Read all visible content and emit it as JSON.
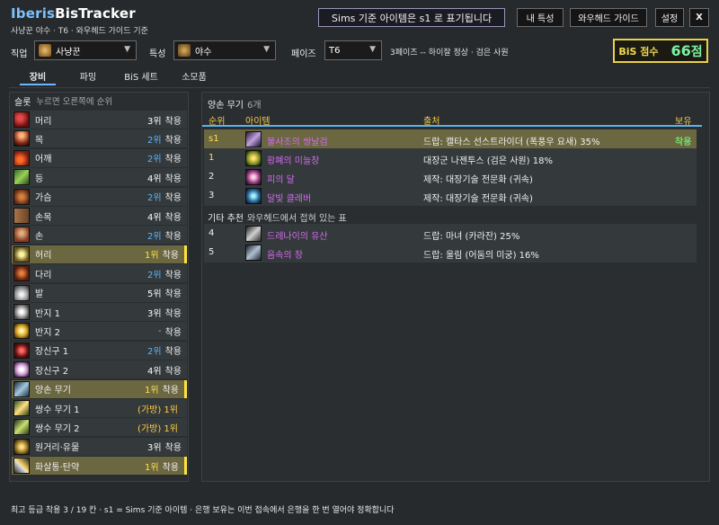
{
  "header": {
    "title_part1": "Iberis",
    "title_part2": "BisTracker",
    "subtitle": "사냥꾼 야수 · T6 · 와우헤드 가이드 기준",
    "sims_notice": "Sims 기준 아이템은 s1 로 표기됩니다",
    "btn_talents": "내 특성",
    "btn_guide": "와우헤드 가이드",
    "btn_settings": "설정",
    "btn_close": "X"
  },
  "filters": {
    "class_label": "직업",
    "class_value": "사냥꾼",
    "spec_label": "특성",
    "spec_value": "야수",
    "phase_label": "페이즈",
    "phase_value": "T6",
    "phase_note": "3페이즈 -- 하이잘 정상 · 검은 사원",
    "bis_score_label": "BiS 점수",
    "bis_score_value": "66",
    "bis_score_unit": "점"
  },
  "tabs": {
    "gear": "장비",
    "farming": "파밍",
    "bis_sets": "BiS 세트",
    "consumables": "소모품"
  },
  "slots_panel": {
    "title": "슬롯",
    "hint": "누르면 오른쪽에 순위",
    "slots": [
      {
        "name": "머리",
        "rank": "3위",
        "suffix": "착용",
        "rank_color": "white",
        "icon": "head-icon",
        "icon_class": "ic-head",
        "highlight": false
      },
      {
        "name": "목",
        "rank": "2위",
        "suffix": "착용",
        "rank_color": "blue",
        "icon": "neck-icon",
        "icon_class": "ic-neck",
        "highlight": false
      },
      {
        "name": "어깨",
        "rank": "2위",
        "suffix": "착용",
        "rank_color": "blue",
        "icon": "shoulder-icon",
        "icon_class": "ic-shoulder",
        "highlight": false
      },
      {
        "name": "등",
        "rank": "4위",
        "suffix": "착용",
        "rank_color": "white",
        "icon": "back-icon",
        "icon_class": "ic-back",
        "highlight": false
      },
      {
        "name": "가슴",
        "rank": "2위",
        "suffix": "착용",
        "rank_color": "blue",
        "icon": "chest-icon",
        "icon_class": "ic-chest",
        "highlight": false
      },
      {
        "name": "손목",
        "rank": "4위",
        "suffix": "착용",
        "rank_color": "white",
        "icon": "wrist-icon",
        "icon_class": "ic-wrist",
        "highlight": false
      },
      {
        "name": "손",
        "rank": "2위",
        "suffix": "착용",
        "rank_color": "blue",
        "icon": "hands-icon",
        "icon_class": "ic-hands",
        "highlight": false
      },
      {
        "name": "허리",
        "rank": "1위",
        "suffix": "착용",
        "rank_color": "yellow",
        "icon": "waist-icon",
        "icon_class": "ic-waist",
        "highlight": true
      },
      {
        "name": "다리",
        "rank": "2위",
        "suffix": "착용",
        "rank_color": "blue",
        "icon": "legs-icon",
        "icon_class": "ic-legs",
        "highlight": false
      },
      {
        "name": "발",
        "rank": "5위",
        "suffix": "착용",
        "rank_color": "white",
        "icon": "feet-icon",
        "icon_class": "ic-feet",
        "highlight": false
      },
      {
        "name": "반지 1",
        "rank": "3위",
        "suffix": "착용",
        "rank_color": "white",
        "icon": "ring-icon",
        "icon_class": "ic-ring1",
        "highlight": false
      },
      {
        "name": "반지 2",
        "rank": "-",
        "suffix": "착용",
        "rank_color": "dim",
        "icon": "ring-icon",
        "icon_class": "ic-ring2",
        "highlight": false
      },
      {
        "name": "장신구 1",
        "rank": "2위",
        "suffix": "착용",
        "rank_color": "blue",
        "icon": "trinket-icon",
        "icon_class": "ic-trinket1",
        "highlight": false
      },
      {
        "name": "장신구 2",
        "rank": "4위",
        "suffix": "착용",
        "rank_color": "white",
        "icon": "trinket-icon",
        "icon_class": "ic-trinket2",
        "highlight": false
      },
      {
        "name": "양손 무기",
        "rank": "1위",
        "suffix": "착용",
        "rank_color": "yellow",
        "icon": "two-hand-weapon-icon",
        "icon_class": "ic-twohand",
        "highlight": true
      },
      {
        "name": "쌍수 무기 1",
        "rank": "(가방) 1위",
        "suffix": "",
        "rank_color": "orange",
        "icon": "main-hand-weapon-icon",
        "icon_class": "ic-dual1",
        "highlight": false
      },
      {
        "name": "쌍수 무기 2",
        "rank": "(가방) 1위",
        "suffix": "",
        "rank_color": "orange",
        "icon": "off-hand-weapon-icon",
        "icon_class": "ic-dual2",
        "highlight": false
      },
      {
        "name": "원거리·유물",
        "rank": "3위",
        "suffix": "착용",
        "rank_color": "white",
        "icon": "ranged-icon",
        "icon_class": "ic-ranged",
        "highlight": false
      },
      {
        "name": "화살통·탄약",
        "rank": "1위",
        "suffix": "착용",
        "rank_color": "yellow",
        "icon": "ammo-icon",
        "icon_class": "ic-ammo",
        "highlight": true
      }
    ]
  },
  "items_panel": {
    "title": "양손 무기",
    "count": "6개",
    "columns": {
      "rank": "순위",
      "item": "아이템",
      "source": "출처",
      "owned": "보유"
    },
    "items": [
      {
        "rank": "s1",
        "name": "불사조의 쌍날검",
        "source": "드랍: 캘타스 선스트라이더 (폭풍우 요새) 35%",
        "owned": "착용",
        "icon": "sword-icon",
        "icon_class": "ic-it1",
        "selected": true
      },
      {
        "rank": "1",
        "name": "황폐의 미늘창",
        "source": "대장군 나젠투스 (검은 사원) 18%",
        "owned": "",
        "icon": "polearm-icon",
        "icon_class": "ic-it2",
        "selected": false
      },
      {
        "rank": "2",
        "name": "피의 달",
        "source": "제작: 대장기술 전문화 (귀속)",
        "owned": "",
        "icon": "axe-icon",
        "icon_class": "ic-it3",
        "selected": false
      },
      {
        "rank": "3",
        "name": "달빛 클레버",
        "source": "제작: 대장기술 전문화 (귀속)",
        "owned": "",
        "icon": "cleaver-icon",
        "icon_class": "ic-it4",
        "selected": false
      }
    ],
    "other_title": "기타 추천",
    "other_hint": "와우헤드에서 접혀 있는 표",
    "other_items": [
      {
        "rank": "4",
        "name": "드레나이의 유산",
        "source": "드랍: 마녀 (카라잔) 25%",
        "owned": "",
        "icon": "staff-icon",
        "icon_class": "ic-it5",
        "selected": false
      },
      {
        "rank": "5",
        "name": "음속의 창",
        "source": "드랍: 울림 (어둠의 미궁) 16%",
        "owned": "",
        "icon": "spear-icon",
        "icon_class": "ic-it6",
        "selected": false
      }
    ]
  },
  "footer": {
    "text": "최고 등급 착용 3 / 19 칸  ·  s1 = Sims 기준 아이템  ·  은행 보유는 이번 접속에서 은행을 한 번 열어야 정확합니다"
  },
  "colors": {
    "accent_blue": "#5ab6ff",
    "highlight_row": "#6b6741",
    "highlight_bar": "#ffe23c",
    "score_border": "#e9d04a",
    "score_value": "#7cf0a2",
    "item_purple": "#d36cf0",
    "column_header": "#f3c84a"
  }
}
